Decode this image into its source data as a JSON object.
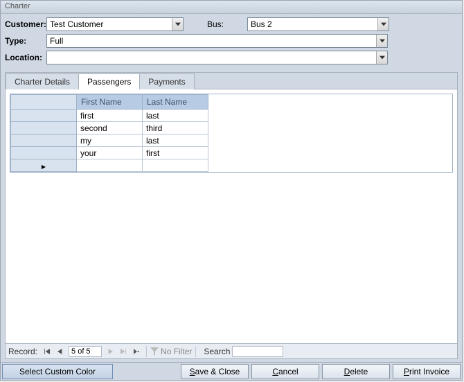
{
  "window": {
    "title": "Charter"
  },
  "form": {
    "customer_label": "Customer:",
    "customer_value": "Test Customer",
    "bus_label": "Bus:",
    "bus_value": "Bus 2",
    "type_label": "Type:",
    "type_value": "Full",
    "location_label": "Location:",
    "location_value": ""
  },
  "tabs": {
    "charter_details": "Charter Details",
    "passengers": "Passengers",
    "payments": "Payments"
  },
  "grid": {
    "headers": {
      "first": "First Name",
      "last": "Last Name"
    },
    "rows": [
      {
        "first": "first",
        "last": "last"
      },
      {
        "first": "second",
        "last": "third"
      },
      {
        "first": "my",
        "last": "last"
      },
      {
        "first": "your",
        "last": "first"
      }
    ]
  },
  "nav": {
    "label": "Record:",
    "position": "5 of 5",
    "filter": "No Filter",
    "search_label": "Search",
    "search_value": ""
  },
  "buttons": {
    "color": "Select Custom Color",
    "save": "ave & Close",
    "cancel": "ancel",
    "delete": "elete",
    "print": "rint Invoice",
    "save_u": "S",
    "cancel_u": "C",
    "delete_u": "D",
    "print_u": "P"
  }
}
